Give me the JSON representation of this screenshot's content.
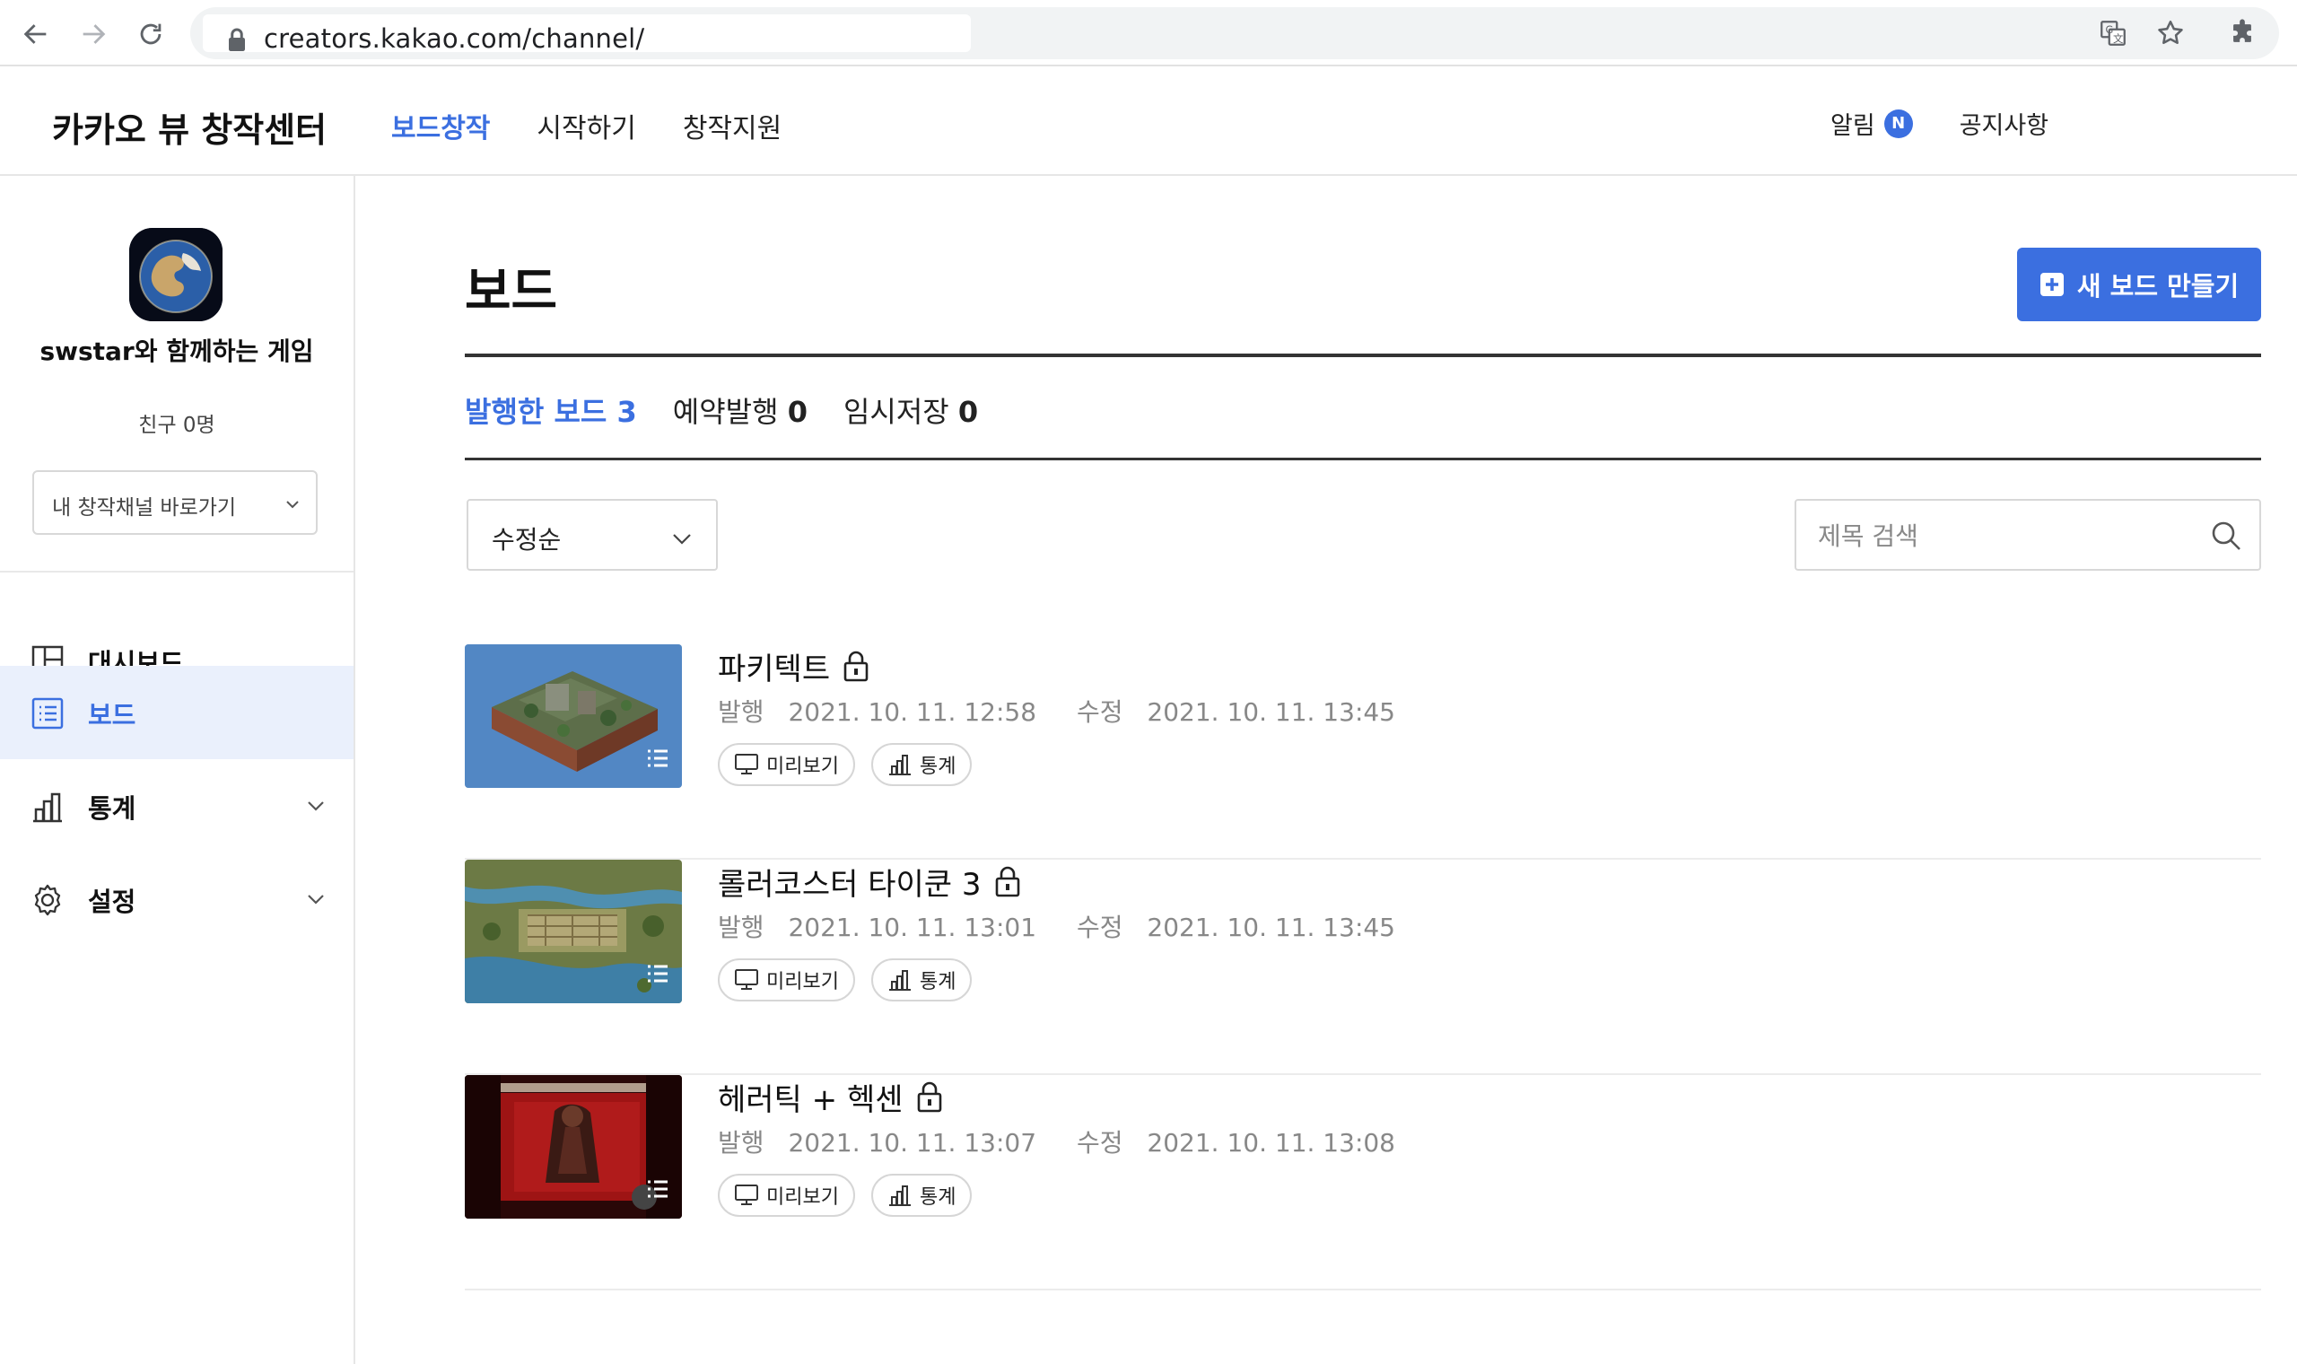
{
  "browser": {
    "url": "creators.kakao.com/channel/",
    "icons": [
      "back-icon",
      "forward-icon",
      "reload-icon",
      "lock-icon",
      "translate-icon",
      "star-icon",
      "extensions-icon"
    ]
  },
  "header": {
    "logo": "카카오 뷰 창작센터",
    "nav": [
      "보드창작",
      "시작하기",
      "창작지원"
    ],
    "alarm_label": "알림",
    "alarm_badge": "N",
    "notice_label": "공지사항"
  },
  "sidebar": {
    "channel_name": "swstar와 함께하는 게임",
    "friends_label": "친구",
    "friends_count": "0명",
    "channel_select": "내 창작채널 바로가기",
    "menu": [
      {
        "label": "대시보드",
        "icon": "dashboard-icon",
        "active": false
      },
      {
        "label": "보드",
        "icon": "list-icon",
        "active": true
      },
      {
        "label": "통계",
        "icon": "chart-icon",
        "active": false
      },
      {
        "label": "설정",
        "icon": "gear-icon",
        "active": false
      }
    ]
  },
  "main": {
    "title": "보드",
    "new_board_button": "새 보드 만들기",
    "tabs": [
      {
        "label": "발행한 보드",
        "count": "3"
      },
      {
        "label": "예약발행",
        "count": "0"
      },
      {
        "label": "임시저장",
        "count": "0"
      }
    ],
    "sort": "수정순",
    "search_placeholder": "제목 검색",
    "preview_label": "미리보기",
    "stats_label": "통계",
    "boards": [
      {
        "title": "파키텍트",
        "published_label": "발행",
        "published": "2021. 10. 11. 12:58",
        "modified_label": "수정",
        "modified": "2021. 10. 11. 13:45"
      },
      {
        "title": "롤러코스터 타이쿤 3",
        "published_label": "발행",
        "published": "2021. 10. 11. 13:01",
        "modified_label": "수정",
        "modified": "2021. 10. 11. 13:45"
      },
      {
        "title": "헤러틱 + 헥센",
        "published_label": "발행",
        "published": "2021. 10. 11. 13:07",
        "modified_label": "수정",
        "modified": "2021. 10. 11. 13:08"
      }
    ]
  },
  "colors": {
    "accent": "#3b6fe0",
    "active_bg": "#eaf0fc",
    "meta_text": "#888888"
  }
}
